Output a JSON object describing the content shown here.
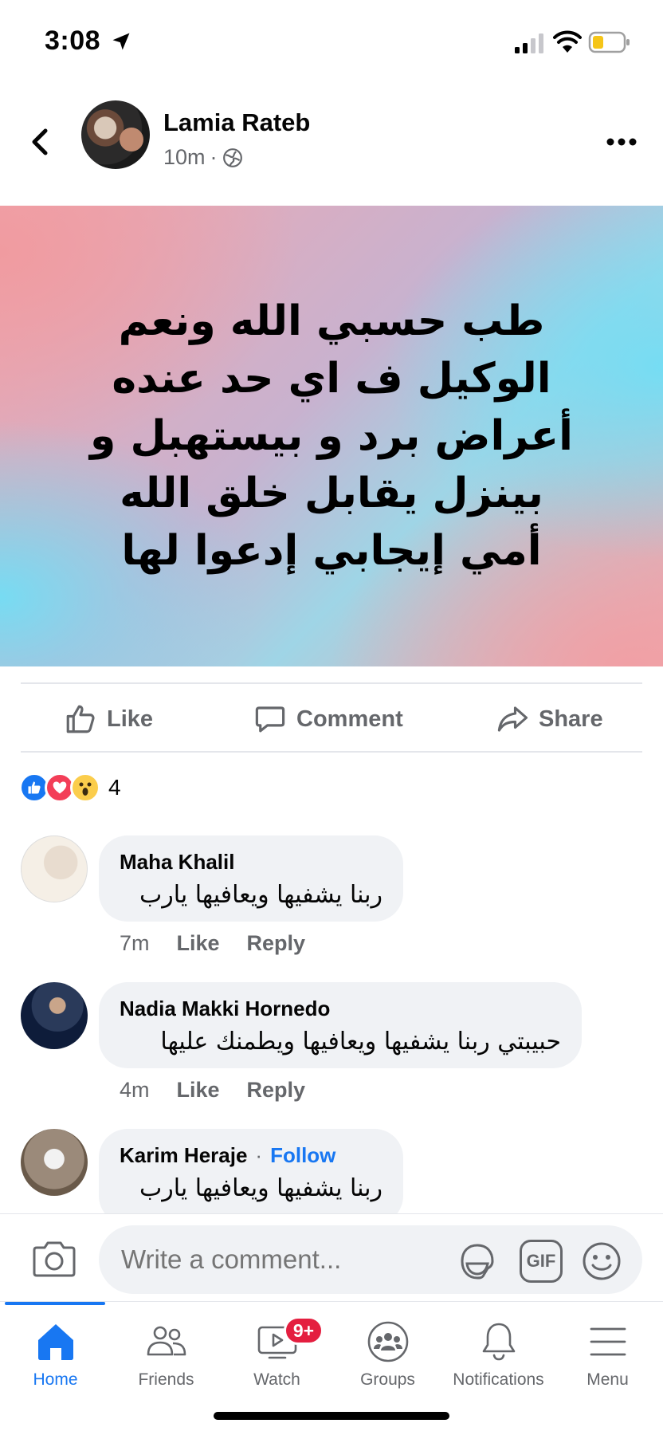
{
  "status_bar": {
    "time": "3:08"
  },
  "post": {
    "author": "Lamia Rateb",
    "time": "10m",
    "privacy_icon": "globe-icon",
    "text_lines": [
      "طب حسبي الله ونعم",
      "الوكيل ف اي حد عنده",
      "أعراض برد و بيستهبل و",
      "بينزل يقابل خلق الله",
      "أمي إيجابي إدعوا لها"
    ],
    "background_colors": [
      "#f0a7b0",
      "#72def5"
    ]
  },
  "actions": {
    "like": "Like",
    "comment": "Comment",
    "share": "Share"
  },
  "reactions": {
    "types": [
      "like",
      "love",
      "wow"
    ],
    "count": "4"
  },
  "comments": [
    {
      "name": "Maha Khalil",
      "text": "ربنا يشفيها ويعافيها يارب",
      "time": "7m",
      "like": "Like",
      "reply": "Reply"
    },
    {
      "name": "Nadia Makki Hornedo",
      "text": "حبيبتي ربنا يشفيها ويعافيها ويطمنك عليها",
      "time": "4m",
      "like": "Like",
      "reply": "Reply"
    },
    {
      "name": "Karim Heraje",
      "follow": "Follow",
      "text": "ربنا يشفيها ويعافيها يارب"
    }
  ],
  "composer": {
    "placeholder": "Write a comment...",
    "gif_label": "GIF"
  },
  "tabs": [
    {
      "label": "Home",
      "icon": "home-icon",
      "active": true
    },
    {
      "label": "Friends",
      "icon": "friends-icon"
    },
    {
      "label": "Watch",
      "icon": "watch-icon",
      "badge": "9+"
    },
    {
      "label": "Groups",
      "icon": "groups-icon"
    },
    {
      "label": "Notifications",
      "icon": "bell-icon"
    },
    {
      "label": "Menu",
      "icon": "menu-icon"
    }
  ],
  "colors": {
    "accent": "#1877f2",
    "badge": "#e41e3f",
    "muted": "#65676b",
    "bubble": "#f0f2f5"
  }
}
